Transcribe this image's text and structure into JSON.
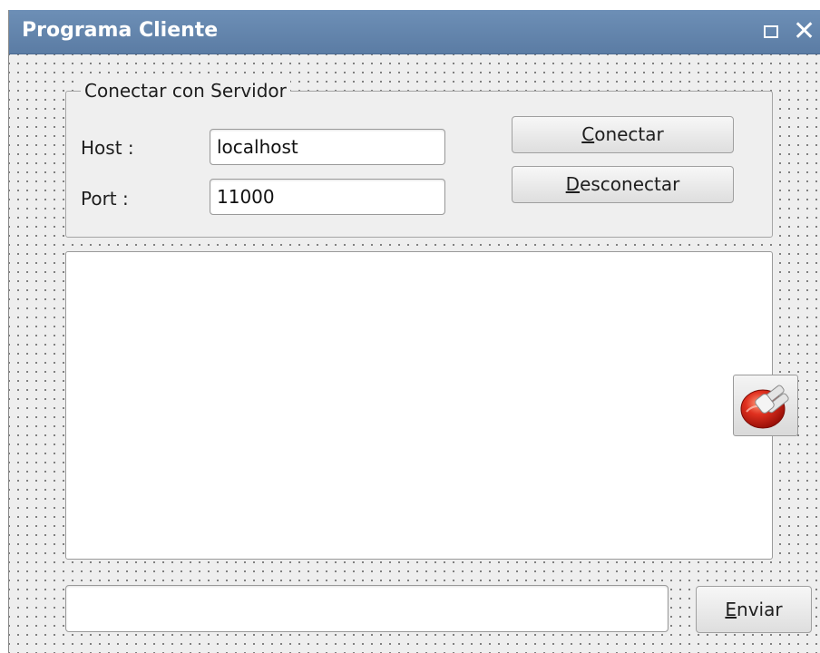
{
  "window": {
    "title": "Programa Cliente",
    "controls": {
      "maximize": "maximize-icon",
      "close": "✕"
    }
  },
  "connection_group": {
    "legend": "Conectar con Servidor",
    "host_label": "Host :",
    "host_value": "localhost",
    "port_label": "Port :",
    "port_value": "11000",
    "connect_button": {
      "mnemonic": "C",
      "rest": "onectar"
    },
    "disconnect_button": {
      "mnemonic": "D",
      "rest": "esconectar"
    }
  },
  "output_area": {
    "text": ""
  },
  "side_button": {
    "icon": "plug-icon"
  },
  "message": {
    "input_value": "",
    "send_button": {
      "mnemonic": "E",
      "rest": "nviar"
    }
  },
  "colors": {
    "titlebar": "#5f7fa8",
    "window_bg": "#eeeeee",
    "plug_red": "#d9261c"
  }
}
